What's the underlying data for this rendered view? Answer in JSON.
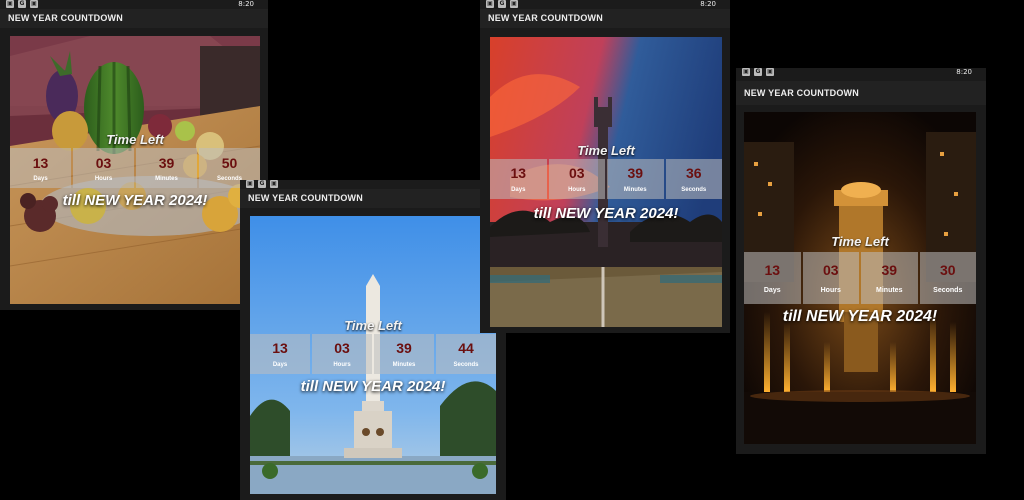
{
  "app_title": "NEW YEAR COUNTDOWN",
  "status_time": "8:20",
  "status_icons": [
    "image-icon",
    "google-icon",
    "notification-icon"
  ],
  "status_glyphs": [
    "▣",
    "G",
    "▣"
  ],
  "time_left_label": "Time Left",
  "till_message": "till NEW YEAR 2024!",
  "unit_labels": {
    "days": "Days",
    "hours": "Hours",
    "minutes": "Minutes",
    "seconds": "Seconds"
  },
  "screens": [
    {
      "background": "fruit-basket-photo",
      "days": "13",
      "hours": "03",
      "minutes": "39",
      "seconds": "50"
    },
    {
      "background": "rizal-monument-photo",
      "days": "13",
      "hours": "03",
      "minutes": "39",
      "seconds": "44"
    },
    {
      "background": "obelisk-sunset-photo",
      "days": "13",
      "hours": "03",
      "minutes": "39",
      "seconds": "36"
    },
    {
      "background": "night-fountain-photo",
      "days": "13",
      "hours": "03",
      "minutes": "39",
      "seconds": "30"
    }
  ],
  "colors": {
    "appbar": "#222222",
    "number": "#6b0f0f",
    "counter_box": "#bebebe"
  }
}
